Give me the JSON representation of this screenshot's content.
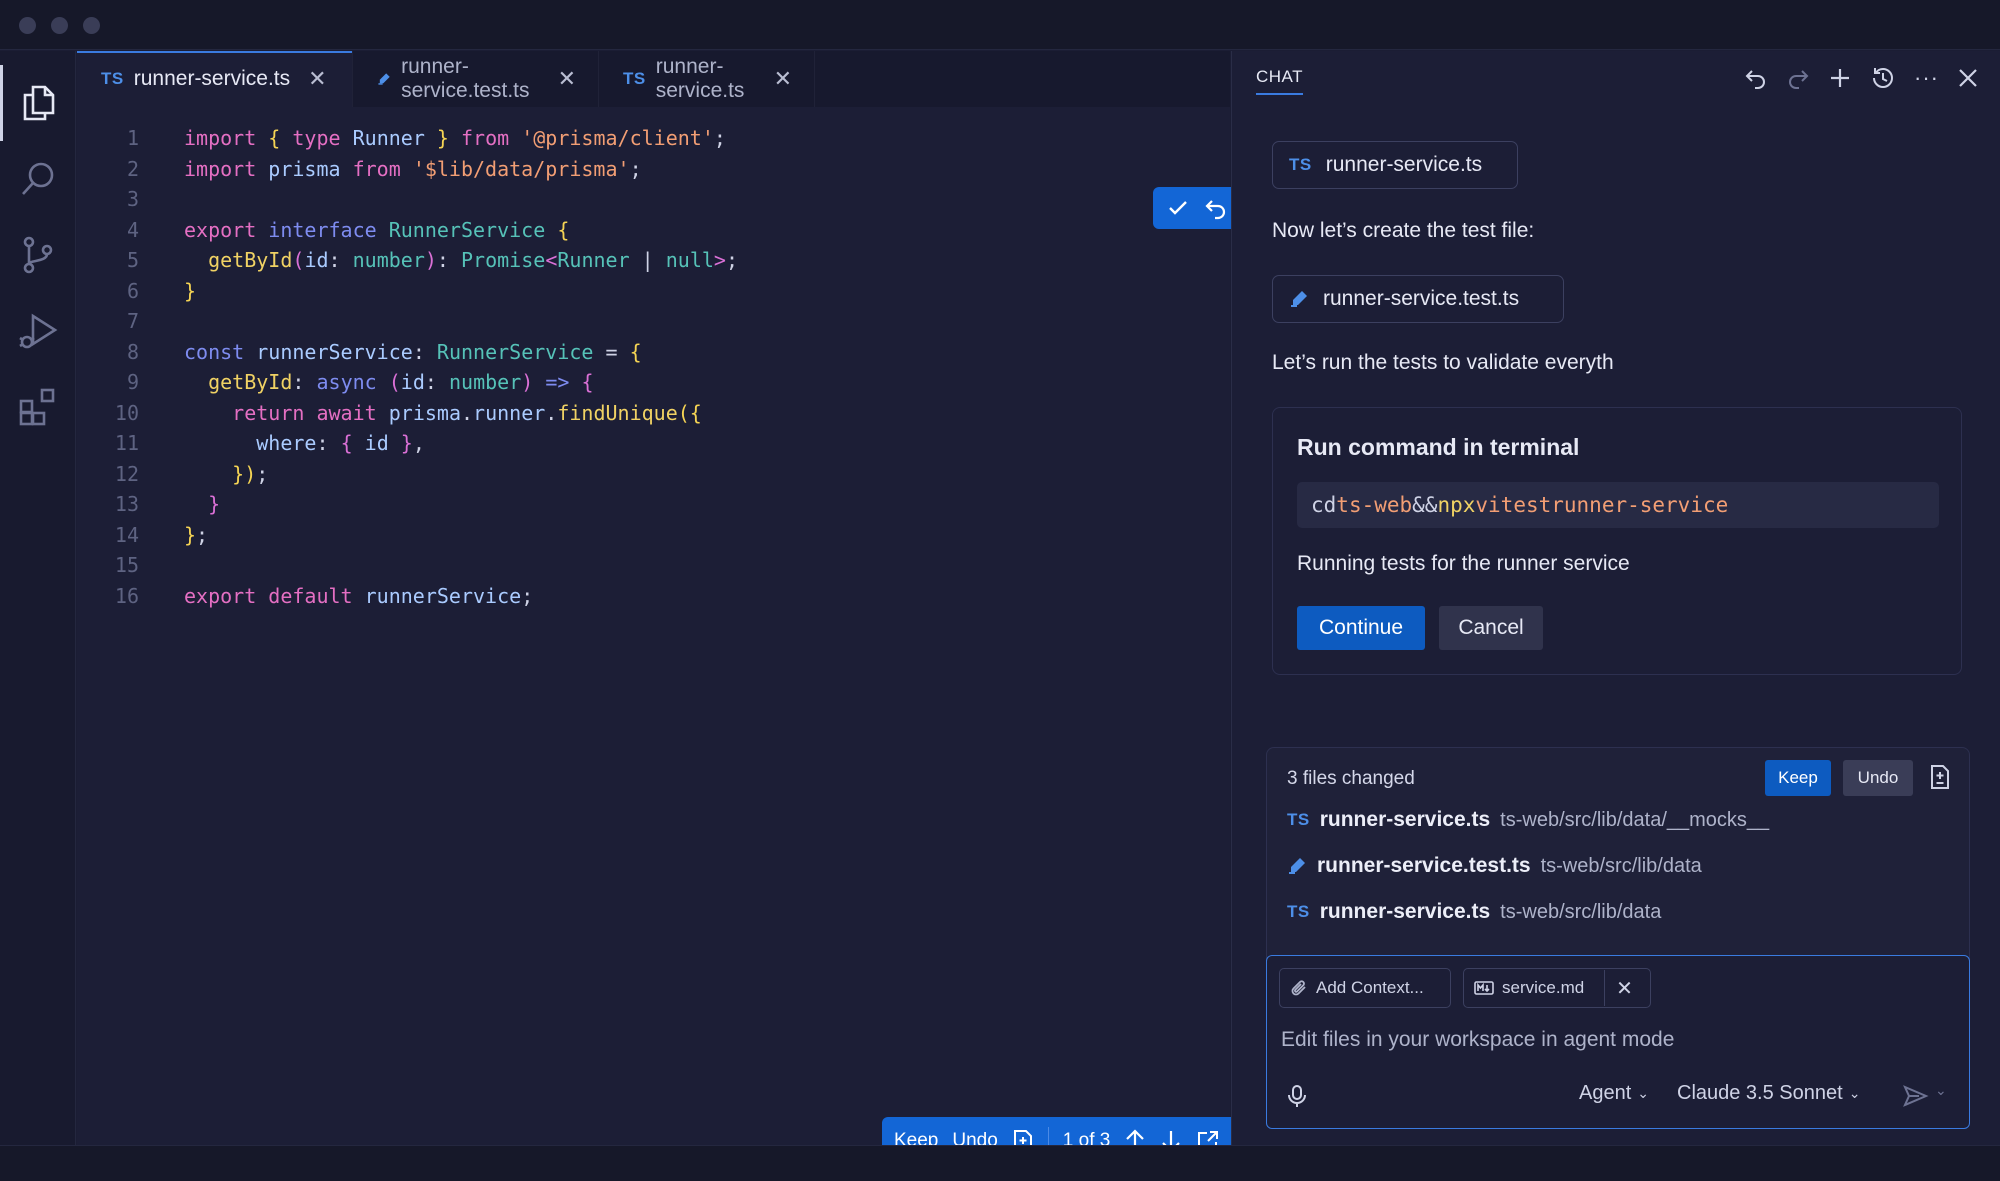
{
  "colors": {
    "accent": "#1366d6",
    "ts_badge": "#4d8fe8",
    "background": "#1c1e36"
  },
  "editor": {
    "tabs": [
      {
        "badge": "TS",
        "label": "runner-service.ts",
        "icon": "pencil-flask-icon",
        "active": true
      },
      {
        "label": "runner-service.test.ts",
        "icon": "test-file-icon"
      },
      {
        "badge": "TS",
        "label": "runner-service.ts"
      }
    ],
    "lines": [
      {
        "n": "1",
        "code": "import { type Runner } from '@prisma/client';"
      },
      {
        "n": "2",
        "code": "import prisma from '$lib/data/prisma';"
      },
      {
        "n": "3",
        "code": ""
      },
      {
        "n": "4",
        "code": "export interface RunnerService {"
      },
      {
        "n": "5",
        "code": "  getById(id: number): Promise<Runner | null>;"
      },
      {
        "n": "6",
        "code": "}"
      },
      {
        "n": "7",
        "code": ""
      },
      {
        "n": "8",
        "code": "const runnerService: RunnerService = {"
      },
      {
        "n": "9",
        "code": "  getById: async (id: number) => {"
      },
      {
        "n": "10",
        "code": "    return await prisma.runner.findUnique({"
      },
      {
        "n": "11",
        "code": "      where: { id },"
      },
      {
        "n": "12",
        "code": "    });"
      },
      {
        "n": "13",
        "code": "  }"
      },
      {
        "n": "14",
        "code": "};"
      },
      {
        "n": "15",
        "code": ""
      },
      {
        "n": "16",
        "code": "export default runnerService;"
      }
    ],
    "diffbar": {
      "keep": "Keep",
      "undo": "Undo",
      "position": "1 of 3"
    }
  },
  "chat": {
    "title": "CHAT",
    "chip1": {
      "badge": "TS",
      "label": "runner-service.ts"
    },
    "msg1": "Now let’s create the test file:",
    "chip2": {
      "label": "runner-service.test.ts"
    },
    "msg2": "Let’s run the tests to validate everyth",
    "command": {
      "title": "Run command in terminal",
      "tokens": [
        "cd",
        "ts-web",
        "&&",
        "npx",
        "vitest",
        "runner-service"
      ],
      "description": "Running tests for the runner service",
      "continue": "Continue",
      "cancel": "Cancel"
    },
    "changes": {
      "title": "3 files changed",
      "keep": "Keep",
      "undo": "Undo",
      "files": [
        {
          "badge": "TS",
          "name": "runner-service.ts",
          "path": "ts-web/src/lib/data/__mocks__"
        },
        {
          "name": "runner-service.test.ts",
          "path": "ts-web/src/lib/data"
        },
        {
          "badge": "TS",
          "name": "runner-service.ts",
          "path": "ts-web/src/lib/data"
        }
      ]
    },
    "input": {
      "add_context": "Add Context...",
      "attachment": "service.md",
      "placeholder": "Edit files in your workspace in agent mode",
      "mode": "Agent",
      "model": "Claude 3.5 Sonnet"
    }
  }
}
